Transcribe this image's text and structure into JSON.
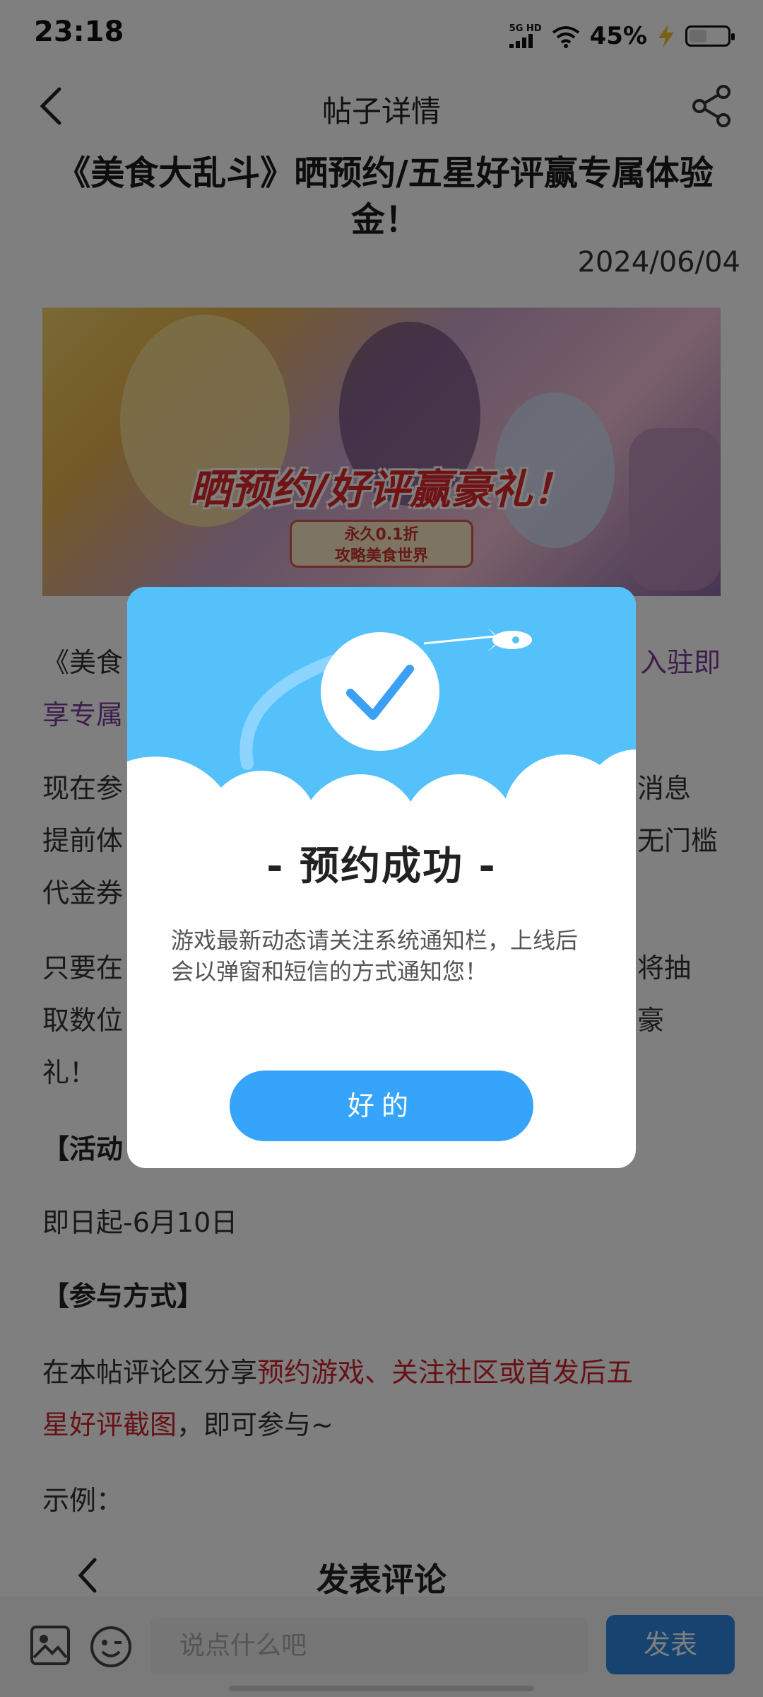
{
  "status_bar": {
    "time": "23:18",
    "network": "5G HD",
    "battery_text": "45%"
  },
  "nav": {
    "title": "帖子详情",
    "back_icon": "chevron-left-icon",
    "share_icon": "share-icon"
  },
  "post": {
    "title": "《美食大乱斗》晒预约/五星好评赢专属体验金！",
    "date": "2024/06/04",
    "banner": {
      "title": "晒预约/好评赢豪礼！",
      "tag_line1": "永久0.1折",
      "tag_line2": "攻略美食世界"
    },
    "para1_a": "《美食",
    "para1_b": "入驻即",
    "para1_c": "享专属",
    "para2_a": "现在参",
    "para2_b": "消息",
    "para2_c": "提前体",
    "para2_d": "无门槛",
    "para2_e": "代金券",
    "para3_a": "只要在",
    "para3_b": "将抽",
    "para3_c": "取数位",
    "para3_d": "豪",
    "para3_e": "礼！",
    "section_time_partial": "【活动",
    "time_range": "即日起-6月10日",
    "section_join": "【参与方式】",
    "join_prefix": "在本帖评论区分享",
    "join_highlight_1": "预约游戏、关注社区或首发后五",
    "join_highlight_2": "星好评截图",
    "join_suffix": "，即可参与~",
    "example_label": "示例："
  },
  "comment": {
    "title": "发表评论",
    "input_placeholder": "说点什么吧",
    "send_label": "发表"
  },
  "dialog": {
    "title": "- 预约成功 -",
    "message": "游戏最新动态请关注系统通知栏，上线后会以弹窗和短信的方式通知您！",
    "button_label": "好的"
  },
  "colors": {
    "dialog_header": "#54c1fb",
    "dialog_button": "#37a4fb",
    "send_button": "#2f86e0",
    "highlight_red": "#d0232b",
    "highlight_purple": "#7a3c9a"
  }
}
